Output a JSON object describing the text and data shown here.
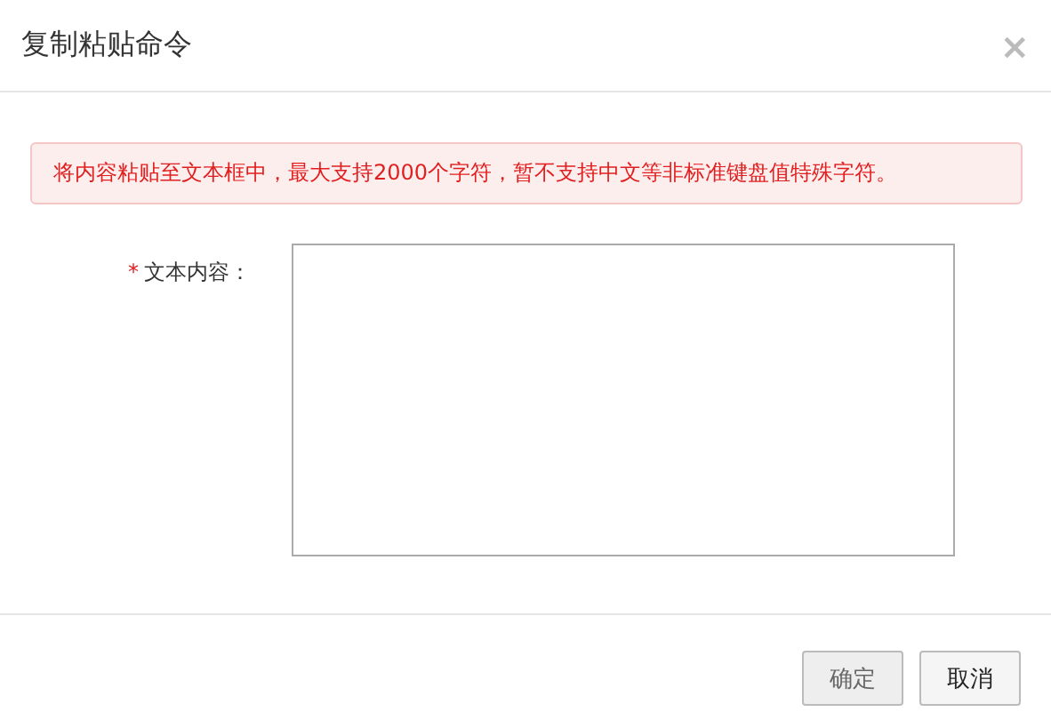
{
  "dialog": {
    "title": "复制粘贴命令",
    "close": "×"
  },
  "alert": {
    "text": "将内容粘贴至文本框中，最大支持2000个字符，暂不支持中文等非标准键盘值特殊字符。"
  },
  "form": {
    "label": "文本内容：",
    "required": true,
    "required_mark": "*"
  },
  "buttons": [
    {
      "label": "确定",
      "kind": "primary"
    },
    {
      "label": "取消",
      "kind": "default"
    }
  ]
}
